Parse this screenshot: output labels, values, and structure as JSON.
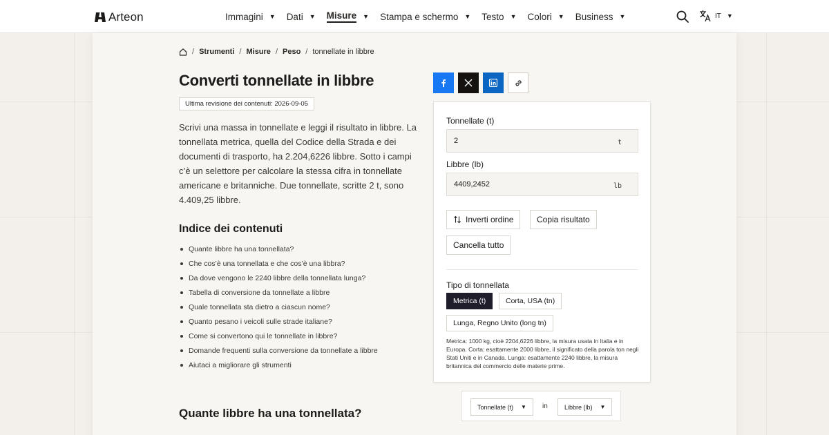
{
  "brand": {
    "name": "Arteon"
  },
  "nav": {
    "items": [
      {
        "label": "Immagini",
        "active": false
      },
      {
        "label": "Dati",
        "active": false
      },
      {
        "label": "Misure",
        "active": true
      },
      {
        "label": "Stampa e schermo",
        "active": false
      },
      {
        "label": "Testo",
        "active": false
      },
      {
        "label": "Colori",
        "active": false
      },
      {
        "label": "Business",
        "active": false
      }
    ],
    "caret": "▼",
    "language": "IT"
  },
  "breadcrumb": {
    "separator": "/",
    "items": [
      "Strumenti",
      "Misure",
      "Peso"
    ],
    "current": "tonnellate in libbre"
  },
  "page": {
    "title": "Converti tonnellate in libbre",
    "revision": "Ultima revisione dei contenuti: 2026-09-05",
    "intro": "Scrivi una massa in tonnellate e leggi il risultato in libbre. La tonnellata metrica, quella del Codice della Strada e dei documenti di trasporto, ha 2.204,6226 libbre. Sotto i campi c’è un selettore per calcolare la stessa cifra in tonnellate americane e britanniche. Due tonnellate, scritte 2 t, sono 4.409,25 libbre.",
    "toc_title": "Indice dei contenuti",
    "toc": [
      "Quante libbre ha una tonnellata?",
      "Che cos’è una tonnellata e che cos’è una libbra?",
      "Da dove vengono le 2240 libbre della tonnellata lunga?",
      "Tabella di conversione da tonnellate a libbre",
      "Quale tonnellata sta dietro a ciascun nome?",
      "Quanto pesano i veicoli sulle strade italiane?",
      "Come si convertono qui le tonnellate in libbre?",
      "Domande frequenti sulla conversione da tonnellate a libbre",
      "Aiutaci a migliorare gli strumenti"
    ],
    "section_title": "Quante libbre ha una tonnellata?"
  },
  "converter": {
    "from_label": "Tonnellate (t)",
    "from_value": "2",
    "from_unit": "t",
    "to_label": "Libbre (lb)",
    "to_value": "4409,2452",
    "to_unit": "lb",
    "swap_label": "Inverti ordine",
    "copy_label": "Copia risultato",
    "clear_label": "Cancella tutto",
    "type_label": "Tipo di tonnellata",
    "types": [
      {
        "label": "Metrica (t)",
        "selected": true
      },
      {
        "label": "Corta, USA (tn)",
        "selected": false
      },
      {
        "label": "Lunga, Regno Unito (long tn)",
        "selected": false
      }
    ],
    "type_description": "Metrica: 1000 kg, cioè 2204,6226 libbre, la misura usata in Italia e in Europa. Corta: esattamente 2000 libbre, il significato della parola ton negli Stati Uniti e in Canada. Lunga: esattamente 2240 libbre, la misura britannica del commercio delle materie prime."
  },
  "unit_selector": {
    "from": "Tonnellate (t)",
    "joiner": "in",
    "to": "Libbre (lb)"
  },
  "colors": {
    "accent_dark": "#1f1d2b",
    "facebook": "#1877f2",
    "x": "#15120f",
    "linkedin": "#0a66c2"
  },
  "icons": {
    "search": "search-icon",
    "translate": "translate-icon",
    "home": "home-icon",
    "swap": "swap-icon",
    "link": "link-icon"
  }
}
